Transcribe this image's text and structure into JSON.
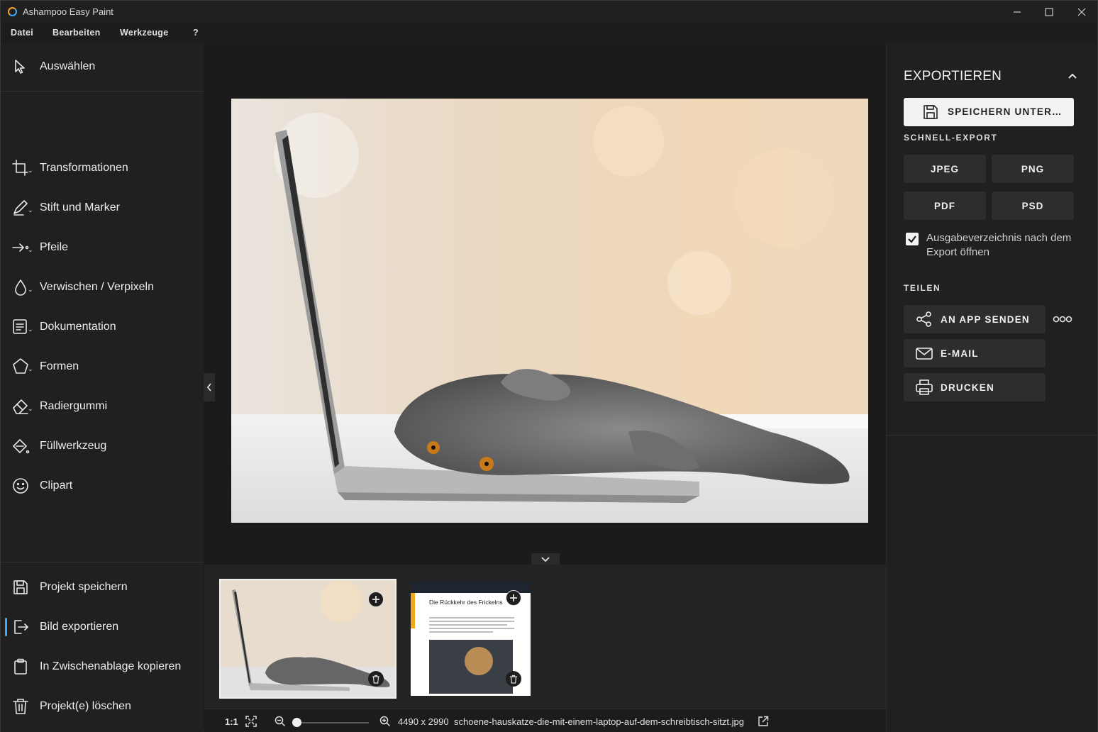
{
  "window": {
    "title": "Ashampoo Easy Paint"
  },
  "menu": {
    "items": [
      "Datei",
      "Bearbeiten",
      "Werkzeuge",
      "?"
    ]
  },
  "sidebar": {
    "select": "Auswählen",
    "tools": [
      "Transformationen",
      "Stift und Marker",
      "Pfeile",
      "Verwischen / Verpixeln",
      "Dokumentation",
      "Formen",
      "Radiergummi",
      "Füllwerkzeug",
      "Clipart"
    ],
    "actions": [
      "Projekt speichern",
      "Bild exportieren",
      "In Zwischenablage kopieren",
      "Projekt(e) löschen"
    ],
    "active_action": "Bild exportieren"
  },
  "export_panel": {
    "title": "EXPORTIEREN",
    "save_as": "SPEICHERN UNTER…",
    "quick_export_title": "SCHNELL-EXPORT",
    "formats": [
      "JPEG",
      "PNG",
      "PDF",
      "PSD"
    ],
    "open_output_dir": {
      "label": "Ausgabeverzeichnis nach dem Export öffnen",
      "checked": true
    },
    "share_title": "TEILEN",
    "share": {
      "send_to_app": "AN APP SENDEN",
      "email": "E-MAIL",
      "print": "DRUCKEN"
    }
  },
  "thumbnails": {
    "second": {
      "headline": "Die Rückkehr des Frickelns"
    }
  },
  "status": {
    "zoom_actual": "1:1",
    "zoom_level": 0.0,
    "dimensions": "4490 x 2990",
    "filename": "schoene-hauskatze-die-mit-einem-laptop-auf-dem-schreibtisch-sitzt.jpg"
  },
  "colors": {
    "accent": "#3fa9f5",
    "background": "#1c1c1c",
    "panel": "#202020"
  }
}
